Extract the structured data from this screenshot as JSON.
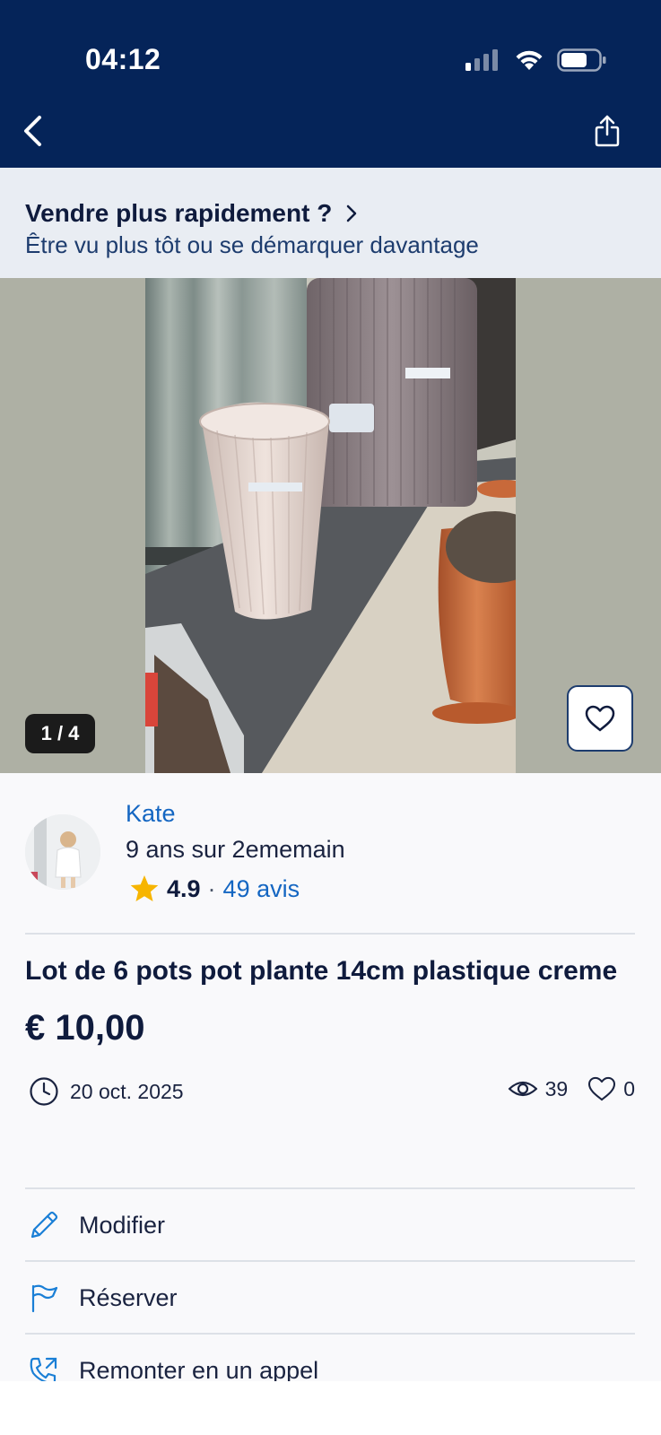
{
  "status_bar": {
    "time": "04:12"
  },
  "header": {
    "back_icon": "chevron-left-icon",
    "share_icon": "share-icon"
  },
  "promo": {
    "title": "Vendre plus rapidement ?",
    "subtitle": "Être vu plus tôt ou se démarquer davantage"
  },
  "photo": {
    "counter": "1 / 4",
    "current": 1,
    "total": 4
  },
  "seller": {
    "name": "Kate",
    "since": "9 ans sur 2ememain",
    "rating": "4.9",
    "separator": "·",
    "reviews": "49 avis"
  },
  "listing": {
    "title": "Lot de 6 pots pot plante 14cm plastique creme",
    "price": "€ 10,00",
    "date": "20 oct. 2025",
    "views": "39",
    "favorites": "0"
  },
  "actions": [
    {
      "label": "Modifier",
      "icon": "pencil-icon"
    },
    {
      "label": "Réserver",
      "icon": "flag-icon"
    },
    {
      "label": "Remonter en un appel",
      "icon": "phone-callback-icon"
    }
  ],
  "colors": {
    "header_bg": "#052459",
    "accent_link": "#1466c2",
    "promo_bg": "#e9edf3",
    "star": "#f7b500",
    "icon_blue": "#1a7fd6"
  }
}
